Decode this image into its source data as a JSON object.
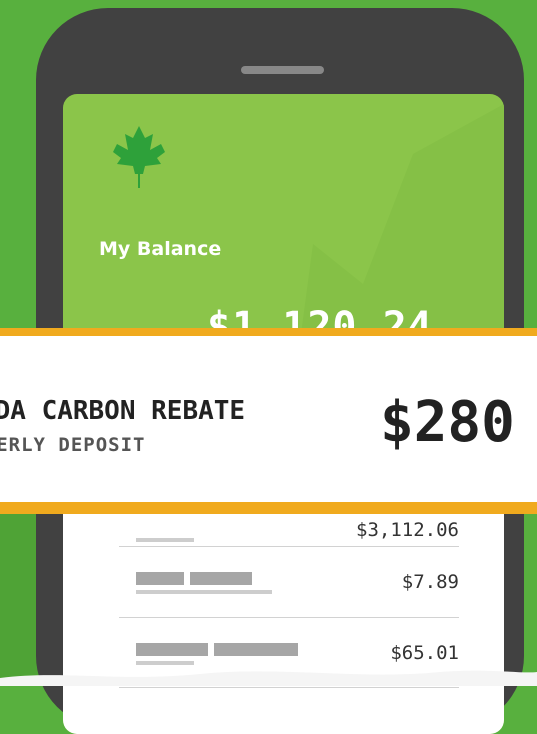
{
  "app": {
    "balance_label": "My Balance",
    "balance_amount": "$1,120.24",
    "logo_icon": "maple-leaf-icon",
    "accent_color": "#8bc54a",
    "background_color": "#58b03e"
  },
  "banner": {
    "title": "CANADA CARBON REBATE",
    "subtitle": "QUARTERLY DEPOSIT",
    "amount": "$280",
    "border_color": "#f0aa1e"
  },
  "transactions": [
    {
      "amount": "$3,112.06"
    },
    {
      "amount": "$7.89"
    },
    {
      "amount": "$65.01"
    }
  ]
}
